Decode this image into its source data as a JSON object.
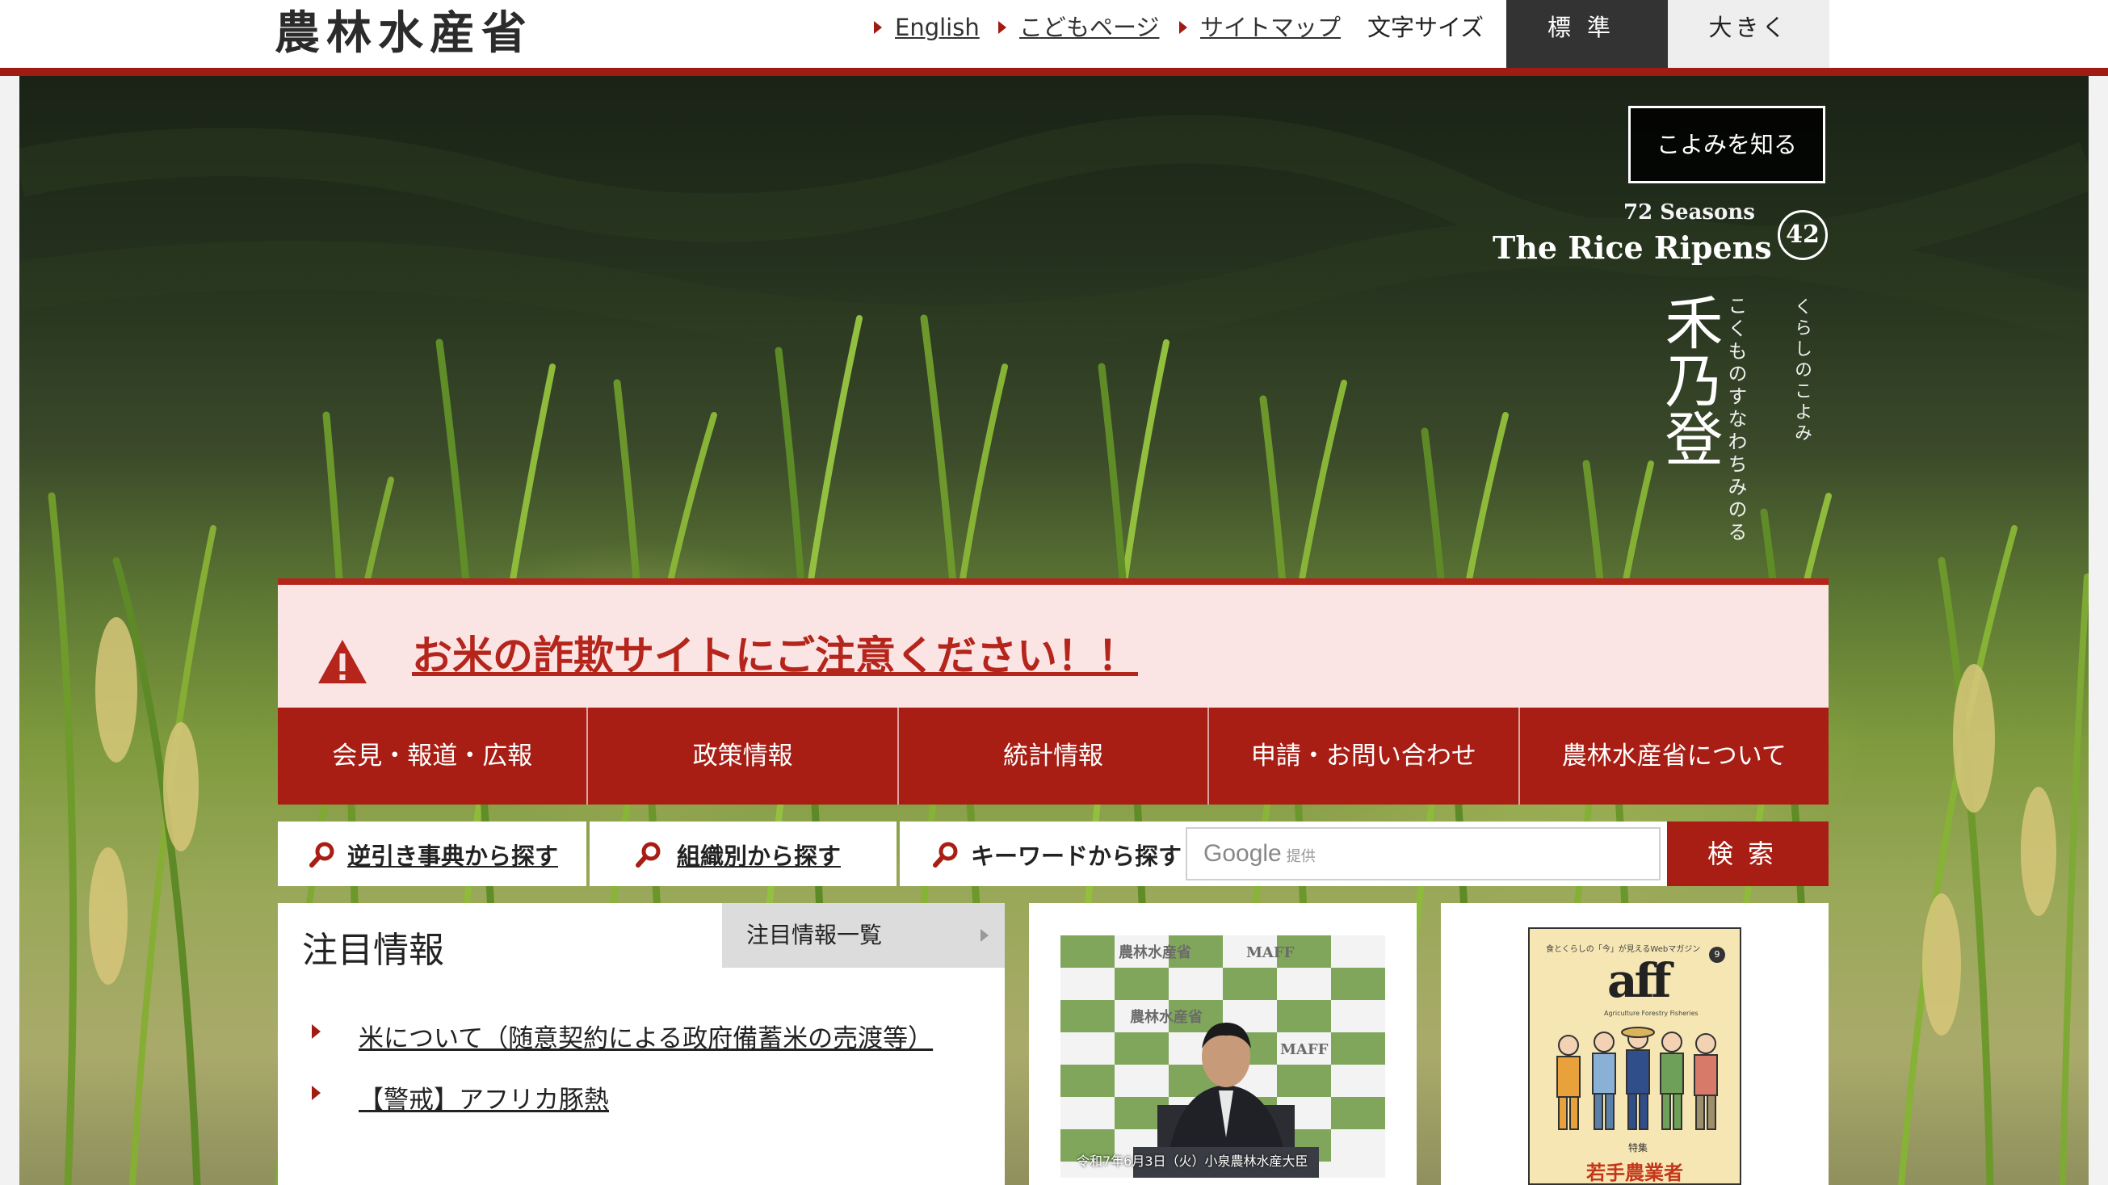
{
  "header": {
    "logo": "農林水産省",
    "links": [
      {
        "label": "English"
      },
      {
        "label": "こどもページ"
      },
      {
        "label": "サイトマップ"
      }
    ],
    "font_size_label": "文字サイズ",
    "font_size_standard": "標準",
    "font_size_large": "大きく"
  },
  "hero": {
    "koyomi_button": "こよみを知る",
    "season_label": "72 Seasons",
    "season_title": "The Rice Ripens",
    "season_number": "42",
    "season_kanji": "禾乃登",
    "season_reading": "こくものすなわちみのる",
    "koyomi_label": "くらしのこよみ"
  },
  "alert": {
    "text": "お米の詐欺サイトにご注意ください！！"
  },
  "nav": [
    {
      "label": "会見・報道・広報"
    },
    {
      "label": "政策情報"
    },
    {
      "label": "統計情報"
    },
    {
      "label": "申請・お問い合わせ"
    },
    {
      "label": "農林水産省について"
    }
  ],
  "search": {
    "reverse_dictionary": "逆引き事典から探す",
    "by_organization": "組織別から探す",
    "by_keyword": "キーワードから探す",
    "google_logo": "Google",
    "google_provided": "提供",
    "submit": "検索"
  },
  "featured": {
    "title": "注目情報",
    "more_label": "注目情報一覧",
    "items": [
      {
        "label": "米について（随意契約による政府備蓄米の売渡等）"
      },
      {
        "label": "【警戒】アフリカ豚熱"
      }
    ]
  },
  "press_photo": {
    "backdrop_text": [
      "農林水産省",
      "MAFF"
    ],
    "caption": "令和7年6月3日（火）小泉農林水産大臣"
  },
  "magazine": {
    "header": "食とくらしの「今」が見えるWebマガジン",
    "logo": "aff",
    "subtitle": "Agriculture Forestry Fisheries",
    "issue": "9",
    "feature_label": "特集",
    "feature_title": "若手農業者"
  },
  "colors": {
    "brand_red": "#a81e14",
    "alert_bg": "#fbe4e4",
    "dark_button": "#333333"
  }
}
